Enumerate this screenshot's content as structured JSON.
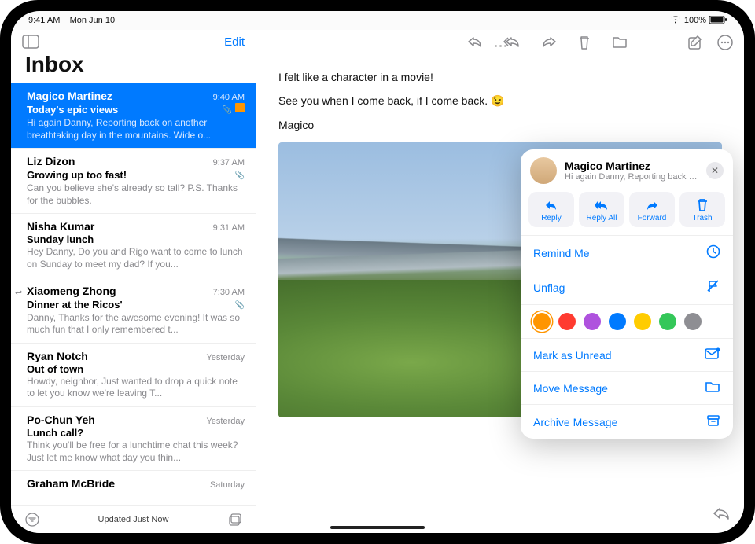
{
  "status": {
    "time": "9:41 AM",
    "date": "Mon Jun 10",
    "battery": "100%"
  },
  "sidebar": {
    "edit": "Edit",
    "title": "Inbox",
    "updated": "Updated Just Now",
    "messages": [
      {
        "sender": "Magico Martinez",
        "time": "9:40 AM",
        "subject": "Today's epic views",
        "preview": "Hi again Danny, Reporting back on another breathtaking day in the mountains. Wide o...",
        "flagged": true,
        "attach": true
      },
      {
        "sender": "Liz Dizon",
        "time": "9:37 AM",
        "subject": "Growing up too fast!",
        "preview": "Can you believe she's already so tall? P.S. Thanks for the bubbles.",
        "attach": true
      },
      {
        "sender": "Nisha Kumar",
        "time": "9:31 AM",
        "subject": "Sunday lunch",
        "preview": "Hey Danny, Do you and Rigo want to come to lunch on Sunday to meet my dad? If you..."
      },
      {
        "sender": "Xiaomeng Zhong",
        "time": "7:30 AM",
        "subject": "Dinner at the Ricos'",
        "preview": "Danny, Thanks for the awesome evening! It was so much fun that I only remembered t...",
        "attach": true,
        "replied": true
      },
      {
        "sender": "Ryan Notch",
        "time": "Yesterday",
        "subject": "Out of town",
        "preview": "Howdy, neighbor, Just wanted to drop a quick note to let you know we're leaving T..."
      },
      {
        "sender": "Po-Chun Yeh",
        "time": "Yesterday",
        "subject": "Lunch call?",
        "preview": "Think you'll be free for a lunchtime chat this week? Just let me know what day you thin..."
      },
      {
        "sender": "Graham McBride",
        "time": "Saturday",
        "subject": "",
        "preview": ""
      }
    ]
  },
  "email": {
    "line1": "I felt like a character in a movie!",
    "line2": "See you when I come back, if I come back. 😉",
    "signature": "Magico"
  },
  "popover": {
    "name": "Magico Martinez",
    "sub": "Hi again Danny, Reporting back o...",
    "actions": {
      "reply": "Reply",
      "replyAll": "Reply All",
      "forward": "Forward",
      "trash": "Trash"
    },
    "remind": "Remind Me",
    "unflag": "Unflag",
    "markUnread": "Mark as Unread",
    "move": "Move Message",
    "archive": "Archive Message",
    "flagColors": [
      "#ff9500",
      "#ff3b30",
      "#af52de",
      "#007aff",
      "#ffcc00",
      "#34c759",
      "#8e8e93"
    ]
  }
}
